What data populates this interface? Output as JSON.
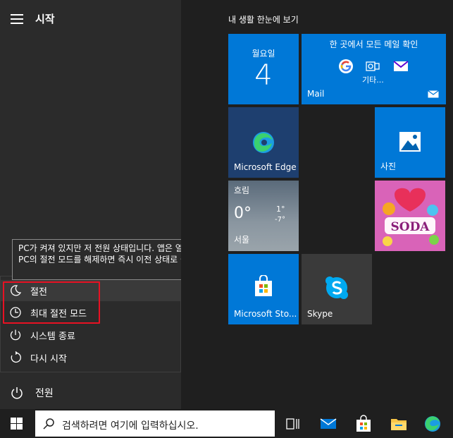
{
  "start": {
    "title": "시작",
    "power_label": "전원"
  },
  "power_menu": {
    "tooltip": "PC가 켜져 있지만 저 전원 상태입니다. 앱은 열려 있으므로 PC의 절전 모드를 해제하면 즉시 이전 상태로 돌아갑니다.",
    "items": [
      {
        "label": "절전",
        "icon": "moon-icon"
      },
      {
        "label": "최대 절전 모드",
        "icon": "clock-icon"
      },
      {
        "label": "시스템 종료",
        "icon": "power-icon"
      },
      {
        "label": "다시 시작",
        "icon": "restart-icon"
      }
    ]
  },
  "tiles": {
    "group_title": "내 생활 한눈에 보기",
    "calendar": {
      "day": "월요일",
      "date": "4"
    },
    "mail": {
      "header": "한 곳에서 모든 메일 확인",
      "etc": "기타...",
      "label": "Mail"
    },
    "edge": {
      "label": "Microsoft Edge"
    },
    "photos": {
      "label": "사진"
    },
    "weather": {
      "condition": "흐림",
      "temp": "0°",
      "high": "1°",
      "low": "-7°",
      "city": "서울"
    },
    "candy": {
      "text": "SODA"
    },
    "store": {
      "label": "Microsoft Sto..."
    },
    "skype": {
      "label": "Skype"
    }
  },
  "taskbar": {
    "search_placeholder": "검색하려면 여기에 입력하십시오."
  },
  "colors": {
    "accent": "#0078d7",
    "highlight": "#e81123"
  }
}
